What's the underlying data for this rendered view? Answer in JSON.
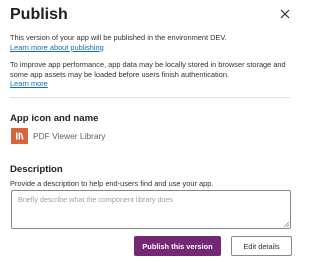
{
  "dialog": {
    "title": "Publish",
    "intro_text": "This version of your app will be published in the environment DEV.",
    "learn_more_publishing": "Learn more about publishing",
    "perf_text": "To improve app performance, app data may be locally stored in browser storage and some app assets may be loaded before users finish authentication.",
    "learn_more": "Learn more"
  },
  "app": {
    "section_title": "App icon and name",
    "name": "PDF Viewer Library",
    "icon": "app-library-icon",
    "icon_color": "#d9633a"
  },
  "description": {
    "section_title": "Description",
    "help_text": "Provide a description to help end-users find and use your app.",
    "placeholder": "Briefly describe what the component library does"
  },
  "actions": {
    "publish_label": "Publish this version",
    "edit_label": "Edit details"
  },
  "colors": {
    "primary": "#742774",
    "link": "#0f6cbd"
  }
}
